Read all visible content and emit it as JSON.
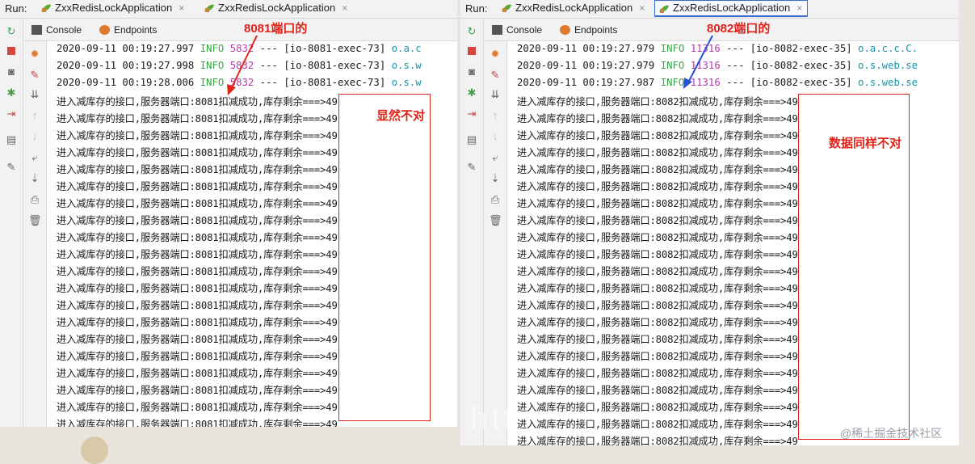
{
  "left": {
    "run_label": "Run:",
    "tabs": [
      {
        "label": "ZxxRedisLockApplication",
        "close": "×"
      },
      {
        "label": "ZxxRedisLockApplication",
        "close": "×"
      }
    ],
    "subtabs": [
      {
        "label": "Console"
      },
      {
        "label": "Endpoints"
      }
    ],
    "log_lines": [
      {
        "ts": "2020-09-11 00:19:27.997",
        "level": "INFO",
        "pid": "5832",
        "sep": "---",
        "thread": "[io-8081-exec-73]",
        "cls": "o.a.c"
      },
      {
        "ts": "2020-09-11 00:19:27.998",
        "level": "INFO",
        "pid": "5832",
        "sep": "---",
        "thread": "[io-8081-exec-73]",
        "cls": "o.s.w"
      },
      {
        "ts": "2020-09-11 00:19:28.006",
        "level": "INFO",
        "pid": "5832",
        "sep": "---",
        "thread": "[io-8081-exec-73]",
        "cls": "o.s.w"
      }
    ],
    "repeat_text": "进入减库存的接口,服务器端口:8081扣减成功,库存剩余===>49",
    "repeat_count": 20,
    "annot_port": "8081端口的",
    "annot_wrong": "显然不对"
  },
  "right": {
    "run_label": "Run:",
    "tabs": [
      {
        "label": "ZxxRedisLockApplication",
        "close": "×"
      },
      {
        "label": "ZxxRedisLockApplication",
        "close": "×"
      }
    ],
    "subtabs": [
      {
        "label": "Console"
      },
      {
        "label": "Endpoints"
      }
    ],
    "log_lines": [
      {
        "ts": "2020-09-11 00:19:27.979",
        "level": "INFO",
        "pid": "11316",
        "sep": "---",
        "thread": "[io-8082-exec-35]",
        "cls": "o.a.c.c.C."
      },
      {
        "ts": "2020-09-11 00:19:27.979",
        "level": "INFO",
        "pid": "11316",
        "sep": "---",
        "thread": "[io-8082-exec-35]",
        "cls": "o.s.web.se"
      },
      {
        "ts": "2020-09-11 00:19:27.987",
        "level": "INFO",
        "pid": "11316",
        "sep": "---",
        "thread": "[io-8082-exec-35]",
        "cls": "o.s.web.se"
      }
    ],
    "repeat_text": "进入减库存的接口,服务器端口:8082扣减成功,库存剩余===>49",
    "repeat_count": 21,
    "annot_port": "8082端口的",
    "annot_wrong": "数据同样不对"
  },
  "watermark": "@稀土掘金技术社区",
  "watermark_big": "htt",
  "colors": {
    "info": "#36a844",
    "pid": "#b13da7",
    "annotation": "#e2231a",
    "arrow_left": "#e2231a",
    "arrow_right": "#2b4fd6",
    "active_tab": "#3a6bd0"
  }
}
